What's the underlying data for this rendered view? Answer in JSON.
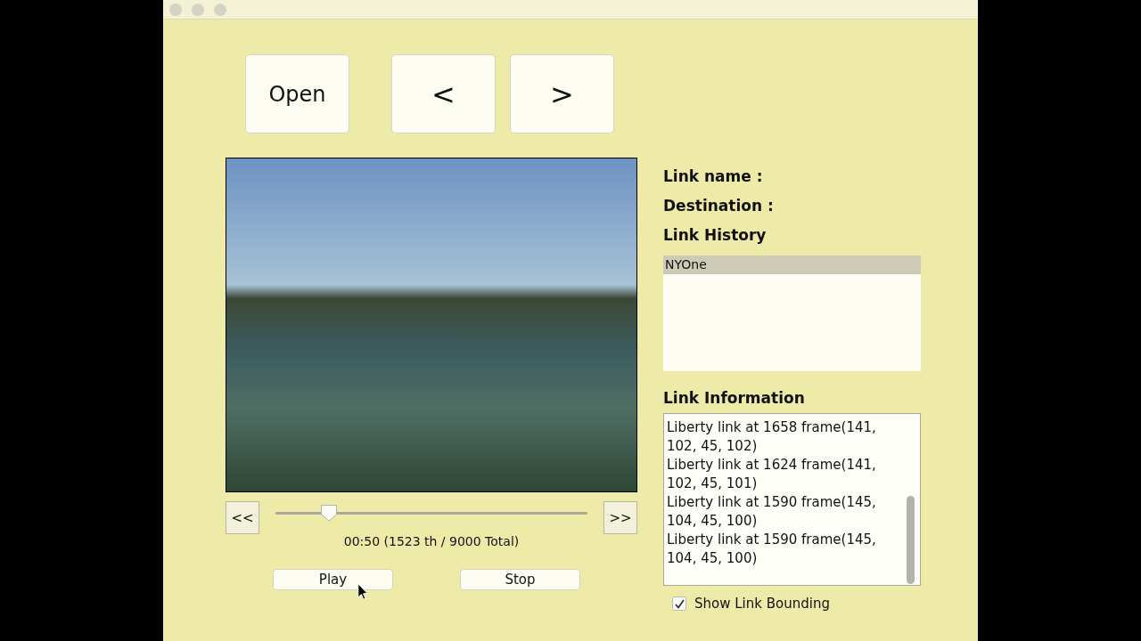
{
  "toolbar": {
    "open_button": "Open",
    "nav_buttons": [
      "<",
      ">"
    ]
  },
  "playback": {
    "rewind_button": "<<",
    "forward_button": ">>",
    "seek": {
      "level": 0.17
    },
    "time_readout": "00:50 (1523 th / 9000 Total)",
    "buttons": [
      "Play",
      "Stop"
    ]
  },
  "link_panel": {
    "link_name_label": "Link name :",
    "destination_label": "Destination :",
    "history_heading": "Link History",
    "history": [
      {
        "label": "NYOne",
        "selected": true
      }
    ],
    "info_heading": "Link Information",
    "info_entries": [
      "Liberty link at 1658 frame(141, 102, 45, 102)",
      "Liberty link at 1624 frame(141, 102, 45, 101)",
      "Liberty link at 1590 frame(145, 104, 45, 100)",
      "Liberty link at 1590 frame(145, 104, 45, 100)"
    ],
    "show_bounding": {
      "label": "Show Link Bounding",
      "checked": true
    }
  }
}
